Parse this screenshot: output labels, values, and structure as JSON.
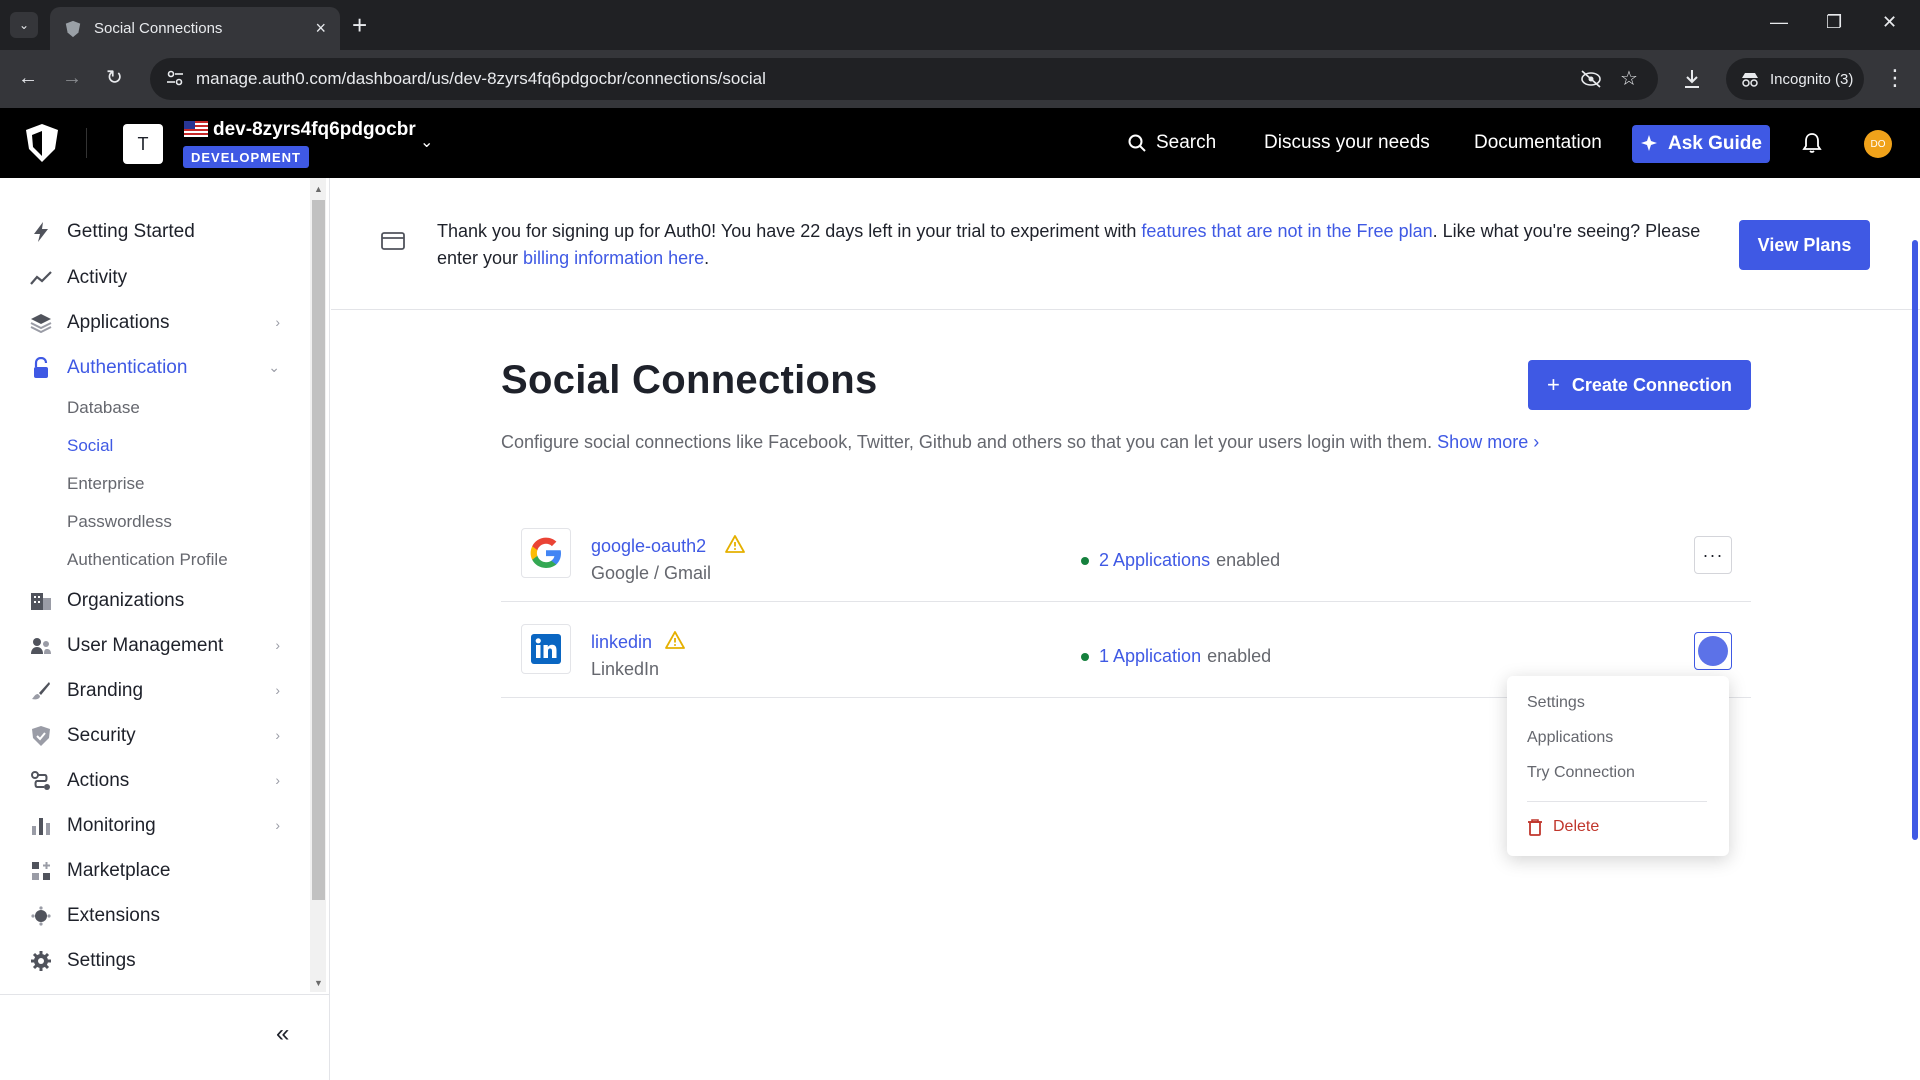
{
  "browser": {
    "tab_title": "Social Connections",
    "url": "manage.auth0.com/dashboard/us/dev-8zyrs4fq6pdgocbr/connections/social",
    "incognito_label": "Incognito (3)"
  },
  "header": {
    "tenant_initial": "T",
    "tenant_name": "dev-8zyrs4fq6pdgocbr",
    "tenant_env": "DEVELOPMENT",
    "search_label": "Search",
    "discuss_label": "Discuss your needs",
    "docs_label": "Documentation",
    "ask_guide_label": "Ask Guide",
    "user_initials": "DO"
  },
  "sidebar": {
    "items": [
      {
        "label": "Getting Started"
      },
      {
        "label": "Activity"
      },
      {
        "label": "Applications"
      },
      {
        "label": "Authentication"
      },
      {
        "label": "Organizations"
      },
      {
        "label": "User Management"
      },
      {
        "label": "Branding"
      },
      {
        "label": "Security"
      },
      {
        "label": "Actions"
      },
      {
        "label": "Monitoring"
      },
      {
        "label": "Marketplace"
      },
      {
        "label": "Extensions"
      },
      {
        "label": "Settings"
      }
    ],
    "auth_sub": [
      "Database",
      "Social",
      "Enterprise",
      "Passwordless",
      "Authentication Profile"
    ],
    "collapse_label": "«"
  },
  "banner": {
    "text_1": "Thank you for signing up for Auth0! You have 22 days left in your trial to experiment with ",
    "link_1": "features that are not in the Free plan",
    "text_2": ". Like what you're seeing? Please enter your ",
    "link_2": "billing information here",
    "text_3": ".",
    "button": "View Plans"
  },
  "page": {
    "title": "Social Connections",
    "create_button": "Create Connection",
    "description": "Configure social connections like Facebook, Twitter, Github and others so that you can let your users login with them. ",
    "show_more": "Show more"
  },
  "connections": [
    {
      "name": "google-oauth2",
      "provider": "Google / Gmail",
      "apps_link": "2 Applications",
      "apps_suffix": "enabled"
    },
    {
      "name": "linkedin",
      "provider": "LinkedIn",
      "apps_link": "1 Application",
      "apps_suffix": "enabled"
    }
  ],
  "menu": {
    "items": [
      "Settings",
      "Applications",
      "Try Connection"
    ],
    "delete": "Delete"
  },
  "colors": {
    "accent": "#3f59e4",
    "status_enabled": "#15803d",
    "danger": "#c0362c",
    "warning": "#e5b000"
  }
}
